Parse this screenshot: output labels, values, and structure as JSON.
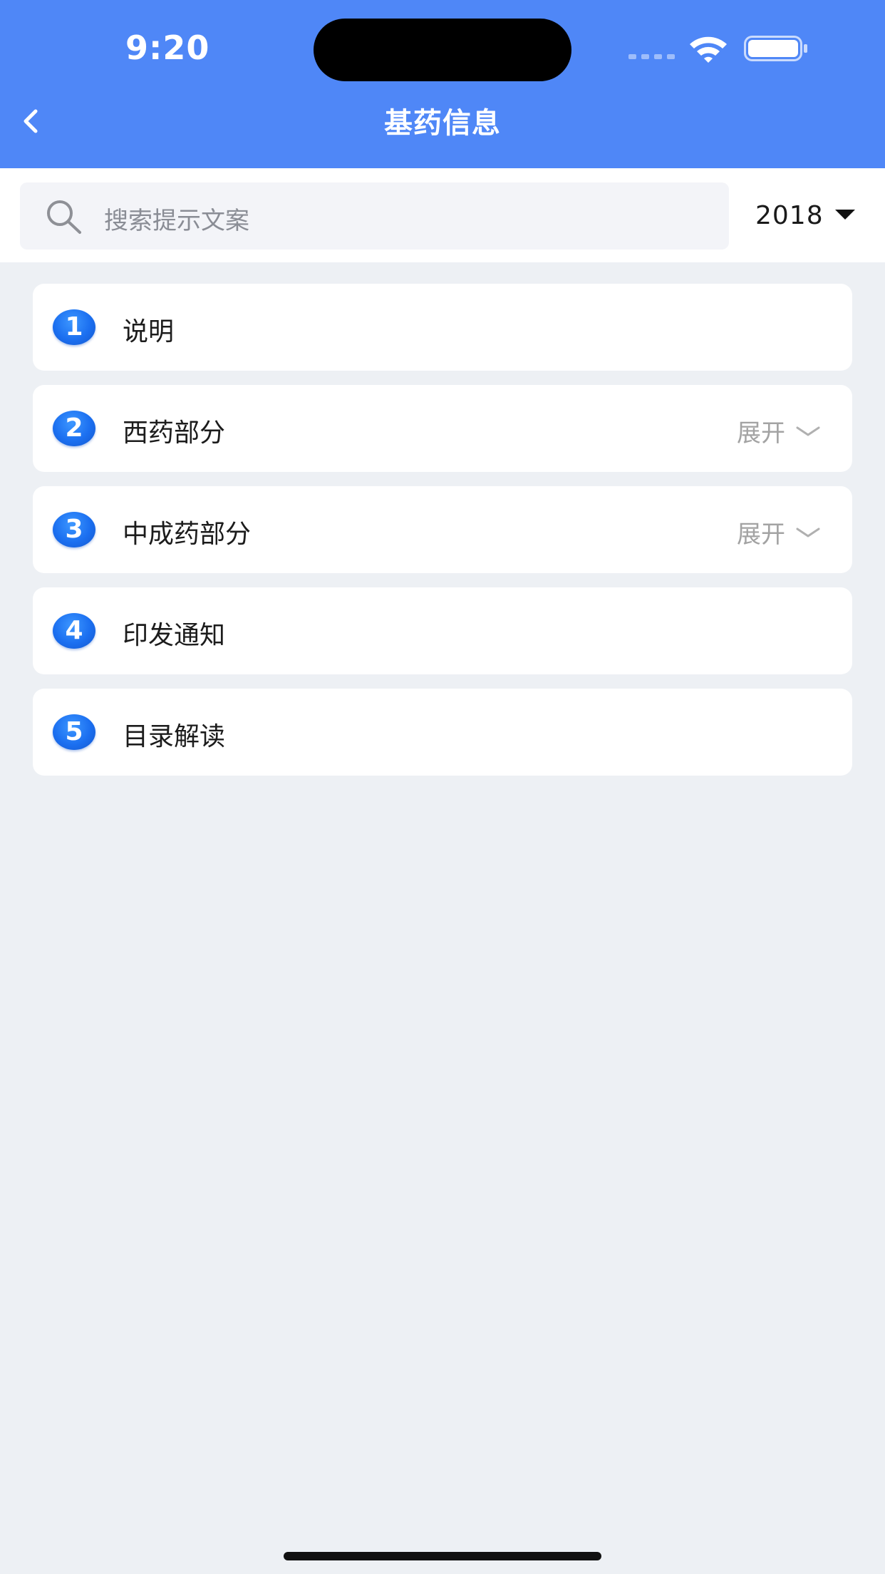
{
  "status_bar": {
    "time": "9:20"
  },
  "nav": {
    "title": "基药信息",
    "back_icon": "chevron-left-icon"
  },
  "search": {
    "placeholder": "搜索提示文案",
    "icon": "search-icon"
  },
  "year_filter": {
    "value": "2018",
    "icon": "caret-down-icon"
  },
  "list": {
    "items": [
      {
        "number": "1",
        "label": "说明"
      },
      {
        "number": "2",
        "label": "西药部分",
        "action": "展开"
      },
      {
        "number": "3",
        "label": "中成药部分",
        "action": "展开"
      },
      {
        "number": "4",
        "label": "印发通知"
      },
      {
        "number": "5",
        "label": "目录解读"
      }
    ]
  },
  "colors": {
    "header": "#4f87f7",
    "background": "#edf0f4",
    "badge": "#1b6ff0",
    "muted_text": "#a3a3a3"
  }
}
